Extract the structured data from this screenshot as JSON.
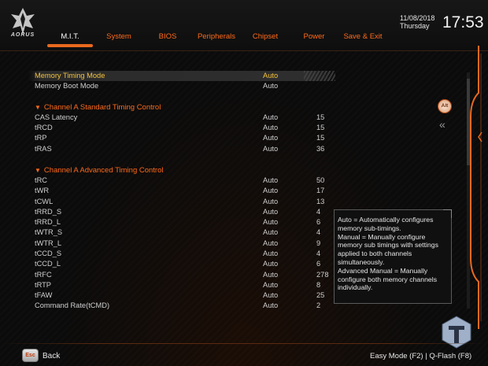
{
  "brand": {
    "logo_text": "AORUS"
  },
  "tabs": [
    {
      "label": "M.I.T.",
      "active": true
    },
    {
      "label": "System",
      "active": false
    },
    {
      "label": "BIOS",
      "active": false
    },
    {
      "label": "Peripherals",
      "active": false
    },
    {
      "label": "Chipset",
      "active": false
    },
    {
      "label": "Power",
      "active": false
    },
    {
      "label": "Save & Exit",
      "active": false
    }
  ],
  "datetime": {
    "date": "11/08/2018",
    "day": "Thursday",
    "time": "17:53"
  },
  "settings": {
    "memory_timing_mode": {
      "label": "Memory Timing Mode",
      "value": "Auto"
    },
    "memory_boot_mode": {
      "label": "Memory Boot Mode",
      "value": "Auto"
    }
  },
  "sections": {
    "standard": "Channel A Standard Timing Control",
    "advanced": "Channel A Advanced Timing Control"
  },
  "standard_rows": [
    {
      "label": "CAS Latency",
      "value": "Auto",
      "num": "15"
    },
    {
      "label": "tRCD",
      "value": "Auto",
      "num": "15"
    },
    {
      "label": "tRP",
      "value": "Auto",
      "num": "15"
    },
    {
      "label": "tRAS",
      "value": "Auto",
      "num": "36"
    }
  ],
  "advanced_rows": [
    {
      "label": "tRC",
      "value": "Auto",
      "num": "50"
    },
    {
      "label": "tWR",
      "value": "Auto",
      "num": "17"
    },
    {
      "label": "tCWL",
      "value": "Auto",
      "num": "13"
    },
    {
      "label": "tRRD_S",
      "value": "Auto",
      "num": "4"
    },
    {
      "label": "tRRD_L",
      "value": "Auto",
      "num": "6"
    },
    {
      "label": "tWTR_S",
      "value": "Auto",
      "num": "4"
    },
    {
      "label": "tWTR_L",
      "value": "Auto",
      "num": "9"
    },
    {
      "label": "tCCD_S",
      "value": "Auto",
      "num": "4"
    },
    {
      "label": "tCCD_L",
      "value": "Auto",
      "num": "6"
    },
    {
      "label": "tRFC",
      "value": "Auto",
      "num": "278"
    },
    {
      "label": "tRTP",
      "value": "Auto",
      "num": "8"
    },
    {
      "label": "tFAW",
      "value": "Auto",
      "num": "25"
    },
    {
      "label": "Command Rate(tCMD)",
      "value": "Auto",
      "num": "2"
    }
  ],
  "help": {
    "line1": "Auto = Automatically configures memory sub-timings.",
    "line2": "Manual = Manually configure memory sub timings with settings applied to both channels simultaneously.",
    "line3": "Advanced Manual = Manually configure both memory channels individually."
  },
  "side": {
    "alt_label": "Alt",
    "collapse_glyph": "«"
  },
  "footer": {
    "esc_label": "Esc",
    "back_label": "Back",
    "right_text": "Easy Mode (F2)  |  Q-Flash (F8)"
  },
  "colors": {
    "accent": "#ff6a1a",
    "selected_text": "#f5c23a",
    "text": "#cfcfcf"
  }
}
